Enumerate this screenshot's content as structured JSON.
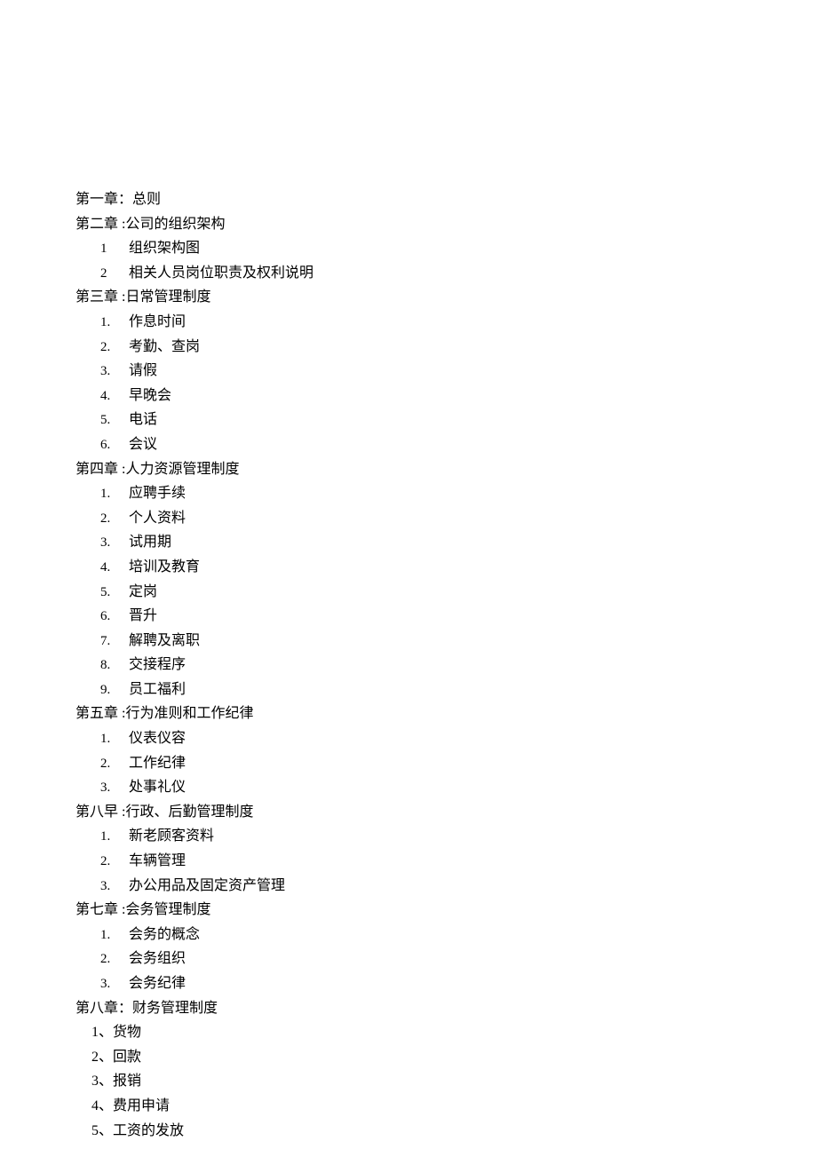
{
  "chapters": [
    {
      "title": "第一章：总则",
      "items": []
    },
    {
      "title": "第二章 :公司的组织架构",
      "items": [
        {
          "num": "1",
          "text": "组织架构图"
        },
        {
          "num": "2",
          "text": "相关人员岗位职责及权利说明"
        }
      ]
    },
    {
      "title": "第三章 :日常管理制度",
      "items": [
        {
          "num": "1.",
          "text": "作息时间"
        },
        {
          "num": "2.",
          "text": "考勤、查岗"
        },
        {
          "num": "3.",
          "text": "请假"
        },
        {
          "num": "4.",
          "text": "早晚会"
        },
        {
          "num": "5.",
          "text": "电话"
        },
        {
          "num": "6.",
          "text": "会议"
        }
      ]
    },
    {
      "title": "第四章 :人力资源管理制度",
      "items": [
        {
          "num": "1.",
          "text": "应聘手续"
        },
        {
          "num": "2.",
          "text": "个人资料"
        },
        {
          "num": "3.",
          "text": "试用期"
        },
        {
          "num": "4.",
          "text": "培训及教育"
        },
        {
          "num": "5.",
          "text": "定岗"
        },
        {
          "num": "6.",
          "text": "晋升"
        },
        {
          "num": "7.",
          "text": "解聘及离职"
        },
        {
          "num": "8.",
          "text": "交接程序"
        },
        {
          "num": "9.",
          "text": "员工福利"
        }
      ]
    },
    {
      "title": "第五章 :行为准则和工作纪律",
      "items": [
        {
          "num": "1.",
          "text": "仪表仪容"
        },
        {
          "num": "2.",
          "text": "工作纪律"
        },
        {
          "num": "3.",
          "text": "处事礼仪"
        }
      ]
    },
    {
      "title": "第八早 :行政、后勤管理制度",
      "items": [
        {
          "num": "1.",
          "text": "新老顾客资料"
        },
        {
          "num": "2.",
          "text": "车辆管理"
        },
        {
          "num": "3.",
          "text": "办公用品及固定资产管理"
        }
      ]
    },
    {
      "title": "第七章 :会务管理制度",
      "items": [
        {
          "num": "1.",
          "text": "会务的概念"
        },
        {
          "num": "2.",
          "text": "会务组织"
        },
        {
          "num": "3.",
          "text": "会务纪律"
        }
      ]
    },
    {
      "title": "第八章：财务管理制度",
      "style": "ch8",
      "items": [
        {
          "num": "1、",
          "text": "货物"
        },
        {
          "num": "2、",
          "text": "回款"
        },
        {
          "num": "3、",
          "text": "报销"
        },
        {
          "num": "4、",
          "text": "费用申请"
        },
        {
          "num": "5、",
          "text": "工资的发放"
        }
      ]
    }
  ]
}
